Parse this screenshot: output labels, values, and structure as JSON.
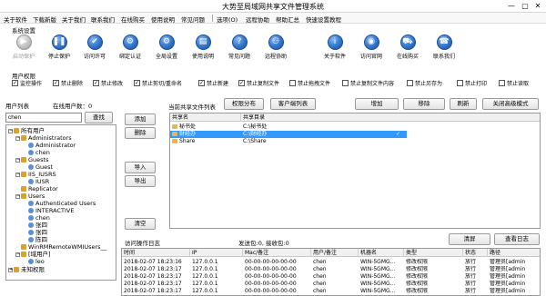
{
  "window": {
    "title": "大势至局域网共享文件管理系统",
    "min": "—",
    "max": "▢",
    "close": "✕"
  },
  "menu": [
    "关于软件",
    "下载新版",
    "关于我们",
    "联系我们",
    "在线购买",
    "使用说明",
    "常见问题",
    "选项(O)",
    "远程协助",
    "帮助汇总",
    "快速设置教程"
  ],
  "system_settings": {
    "label": "系统设置",
    "buttons": [
      {
        "label": "启动保护",
        "icon": "play-icon",
        "glyph": "▶",
        "disabled": true
      },
      {
        "label": "停止保护",
        "icon": "pause-icon",
        "glyph": "❚❚",
        "disabled": false
      },
      {
        "label": "访问许可",
        "icon": "access-icon",
        "glyph": "✔",
        "disabled": false
      },
      {
        "label": "绑定认证",
        "icon": "bind-icon",
        "glyph": "⚙",
        "disabled": false
      },
      {
        "label": "全局设置",
        "icon": "global-settings-icon",
        "glyph": "⚙",
        "disabled": false
      },
      {
        "label": "使用说明",
        "icon": "manual-icon",
        "glyph": "▤",
        "disabled": false
      },
      {
        "label": "常见问题",
        "icon": "faq-icon",
        "glyph": "?",
        "disabled": false
      },
      {
        "label": "远程协助",
        "icon": "remote-icon",
        "glyph": "⚇",
        "disabled": false
      },
      {
        "label": "关于软件",
        "icon": "about-icon",
        "glyph": "i",
        "disabled": false
      },
      {
        "label": "访问官网",
        "icon": "website-icon",
        "glyph": "◉",
        "disabled": false
      },
      {
        "label": "在线购买",
        "icon": "cart-icon",
        "glyph": "⛟",
        "disabled": false
      },
      {
        "label": "联系我们",
        "icon": "contact-icon",
        "glyph": "☎",
        "disabled": false
      }
    ]
  },
  "permissions": {
    "label": "用户权限",
    "items": [
      {
        "label": "监控操作",
        "checked": true
      },
      {
        "label": "禁止删除",
        "checked": true
      },
      {
        "label": "禁止修改",
        "checked": true
      },
      {
        "label": "禁止剪切/重命名",
        "checked": true
      },
      {
        "label": "禁止新建",
        "checked": true
      },
      {
        "label": "禁止复制文件",
        "checked": true
      },
      {
        "label": "禁止拖拽文件",
        "checked": false
      },
      {
        "label": "禁止复制文件内容",
        "checked": false
      },
      {
        "label": "禁止另存为",
        "checked": false
      },
      {
        "label": "禁止打印",
        "checked": false
      },
      {
        "label": "禁止读取",
        "checked": false
      }
    ]
  },
  "users": {
    "label": "用户列表",
    "online_label": "在线用户数：0",
    "search_value": "chen",
    "search_btn": "查找",
    "add_btn": "添加",
    "delete_btn": "删除",
    "import_btn": "导入",
    "export_btn": "导出",
    "clear_btn": "清空",
    "tree": [
      {
        "text": "所有用户",
        "level": 0,
        "type": "group",
        "exp": "−"
      },
      {
        "text": "Administrators",
        "level": 1,
        "type": "group",
        "exp": "−"
      },
      {
        "text": "Administrator",
        "level": 2,
        "type": "user"
      },
      {
        "text": "chen",
        "level": 2,
        "type": "user"
      },
      {
        "text": "Guests",
        "level": 1,
        "type": "group",
        "exp": "−"
      },
      {
        "text": "Guest",
        "level": 2,
        "type": "user"
      },
      {
        "text": "IIS_IUSRS",
        "level": 1,
        "type": "group",
        "exp": "−"
      },
      {
        "text": "IUSR",
        "level": 2,
        "type": "user"
      },
      {
        "text": "Replicator",
        "level": 1,
        "type": "group"
      },
      {
        "text": "Users",
        "level": 1,
        "type": "group",
        "exp": "−"
      },
      {
        "text": "Authenticated Users",
        "level": 2,
        "type": "user"
      },
      {
        "text": "INTERACTIVE",
        "level": 2,
        "type": "user"
      },
      {
        "text": "chen",
        "level": 2,
        "type": "user"
      },
      {
        "text": "张四",
        "level": 2,
        "type": "user"
      },
      {
        "text": "张四",
        "level": 2,
        "type": "user"
      },
      {
        "text": "陈四",
        "level": 2,
        "type": "user"
      },
      {
        "text": "WinRMRemoteWMIUsers__",
        "level": 1,
        "type": "group"
      },
      {
        "text": "[域用户]",
        "level": 1,
        "type": "group",
        "exp": "−"
      },
      {
        "text": "leo",
        "level": 2,
        "type": "user"
      },
      {
        "text": "未知权限",
        "level": 0,
        "type": "group",
        "exp": "+"
      }
    ]
  },
  "shares": {
    "label": "当前共享文件列表",
    "perm_btn": "权限分布",
    "client_btn": "客户端列表",
    "add_btn": "增加",
    "remove_btn": "移除",
    "refresh_btn": "刷新",
    "advanced_btn": "关闭高级模式",
    "col_name": "共享名",
    "col_dir": "共享目录",
    "rows": [
      {
        "name": "秘书处",
        "dir": "C:\\秘书处",
        "check": "",
        "selected": false
      },
      {
        "name": "财经办",
        "dir": "C:\\财经办",
        "check": "✓",
        "selected": true
      },
      {
        "name": "Share",
        "dir": "C:\\Share",
        "check": "",
        "selected": false
      }
    ]
  },
  "log": {
    "label": "访问操作日志",
    "stats": "发送包:0, 接收包:0",
    "clear_btn": "清屏",
    "view_btn": "查看日志",
    "columns": [
      "时间",
      "IP",
      "Mac/备注",
      "用户/备注",
      "机器名",
      "类型",
      "状态",
      "路径"
    ],
    "rows": [
      [
        "2018-02-07 18:23:16",
        "127.0.0.1",
        "00-00-00-00-00-00",
        "chen",
        "WIN-5GMG...",
        "修改权限",
        "放行",
        "管理员[admin"
      ],
      [
        "2018-02-07 18:23:17",
        "127.0.0.1",
        "00-00-00-00-00-00",
        "chen",
        "WIN-5GMG...",
        "修改权限",
        "放行",
        "管理员[admin"
      ],
      [
        "2018-02-07 18:23:17",
        "127.0.0.1",
        "00-00-00-00-00-00",
        "chen",
        "WIN-5GMG...",
        "修改权限",
        "放行",
        "管理员[admin"
      ],
      [
        "2018-02-07 18:23:17",
        "127.0.0.1",
        "00-00-00-00-00-00",
        "chen",
        "WIN-5GMG...",
        "修改权限",
        "放行",
        "管理员[admin"
      ],
      [
        "2018-02-07 18:23:17",
        "127.0.0.1",
        "00-00-00-00-00-00",
        "chen",
        "WIN-5GMG...",
        "修改权限",
        "放行",
        "管理员[admin"
      ]
    ]
  }
}
